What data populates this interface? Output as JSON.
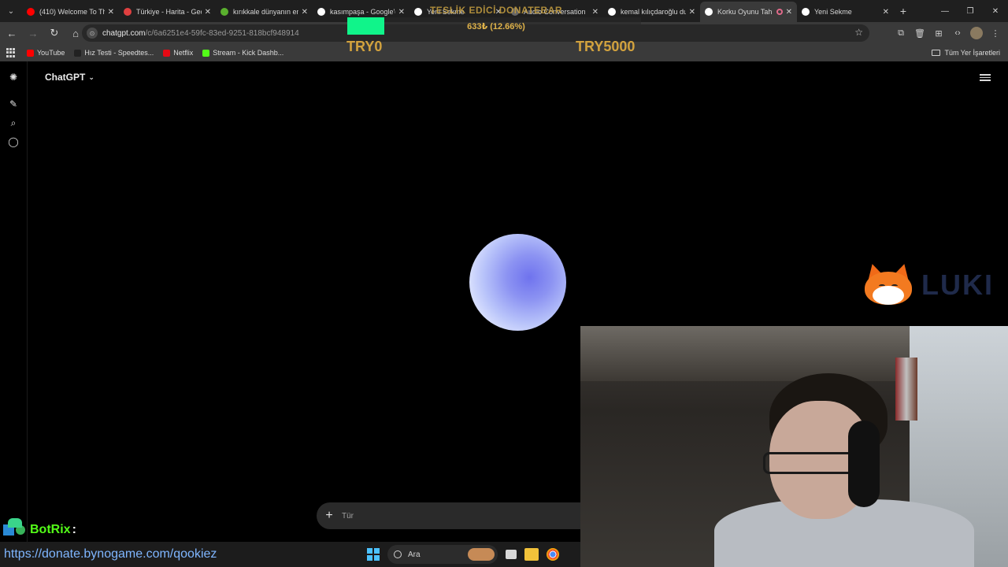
{
  "tabs": [
    {
      "title": "(410) Welcome To Th",
      "favicon_color": "#ff0000",
      "active": false
    },
    {
      "title": "Türkiye - Harita - Gec",
      "favicon_color": "#e04040",
      "active": false
    },
    {
      "title": "kırıkkale dünyanın en",
      "favicon_color": "#5ab02e",
      "active": false
    },
    {
      "title": "kasımpaşa - Google'd",
      "favicon_color": "#ffffff",
      "active": false
    },
    {
      "title": "Yeni Sekme",
      "favicon_color": "#ffffff",
      "active": false
    },
    {
      "title": "Audio Conversation",
      "favicon_color": "#666666",
      "active": false
    },
    {
      "title": "kemal kılıçdaroğlu du",
      "favicon_color": "#ffffff",
      "active": false
    },
    {
      "title": "Korku Oyunu Tah",
      "favicon_color": "#ffffff",
      "active": true
    },
    {
      "title": "Yeni Sekme",
      "favicon_color": "#ffffff",
      "active": false
    }
  ],
  "address": {
    "host": "chatgpt.com",
    "path": "/c/6a6251e4-59fc-83ed-9251-818bcf948914"
  },
  "bookmarks": [
    {
      "label": "YouTube",
      "color": "#ff0000"
    },
    {
      "label": "Hız Testi - Speedtes...",
      "color": "#222222"
    },
    {
      "label": "Netflix",
      "color": "#e50914"
    },
    {
      "label": "Stream - Kick Dashb...",
      "color": "#53fc18"
    }
  ],
  "bookmarks_all": "Tüm Yer İşaretleri",
  "donation": {
    "title": "TESLİK EDİCİ DONATEBAR",
    "amount": "633₺ (12.66%)",
    "progress": 0.1266,
    "min": "TRY0",
    "max": "TRY5000"
  },
  "chatgpt": {
    "model": "ChatGPT",
    "composer_placeholder": "Tür"
  },
  "overlay": {
    "logo_text": "LUKI",
    "bot_name": "BotRix",
    "bot_colon": ":",
    "donate_link": "https://donate.bynogame.com/qookiez"
  },
  "taskbar": {
    "search_label": "Ara"
  }
}
